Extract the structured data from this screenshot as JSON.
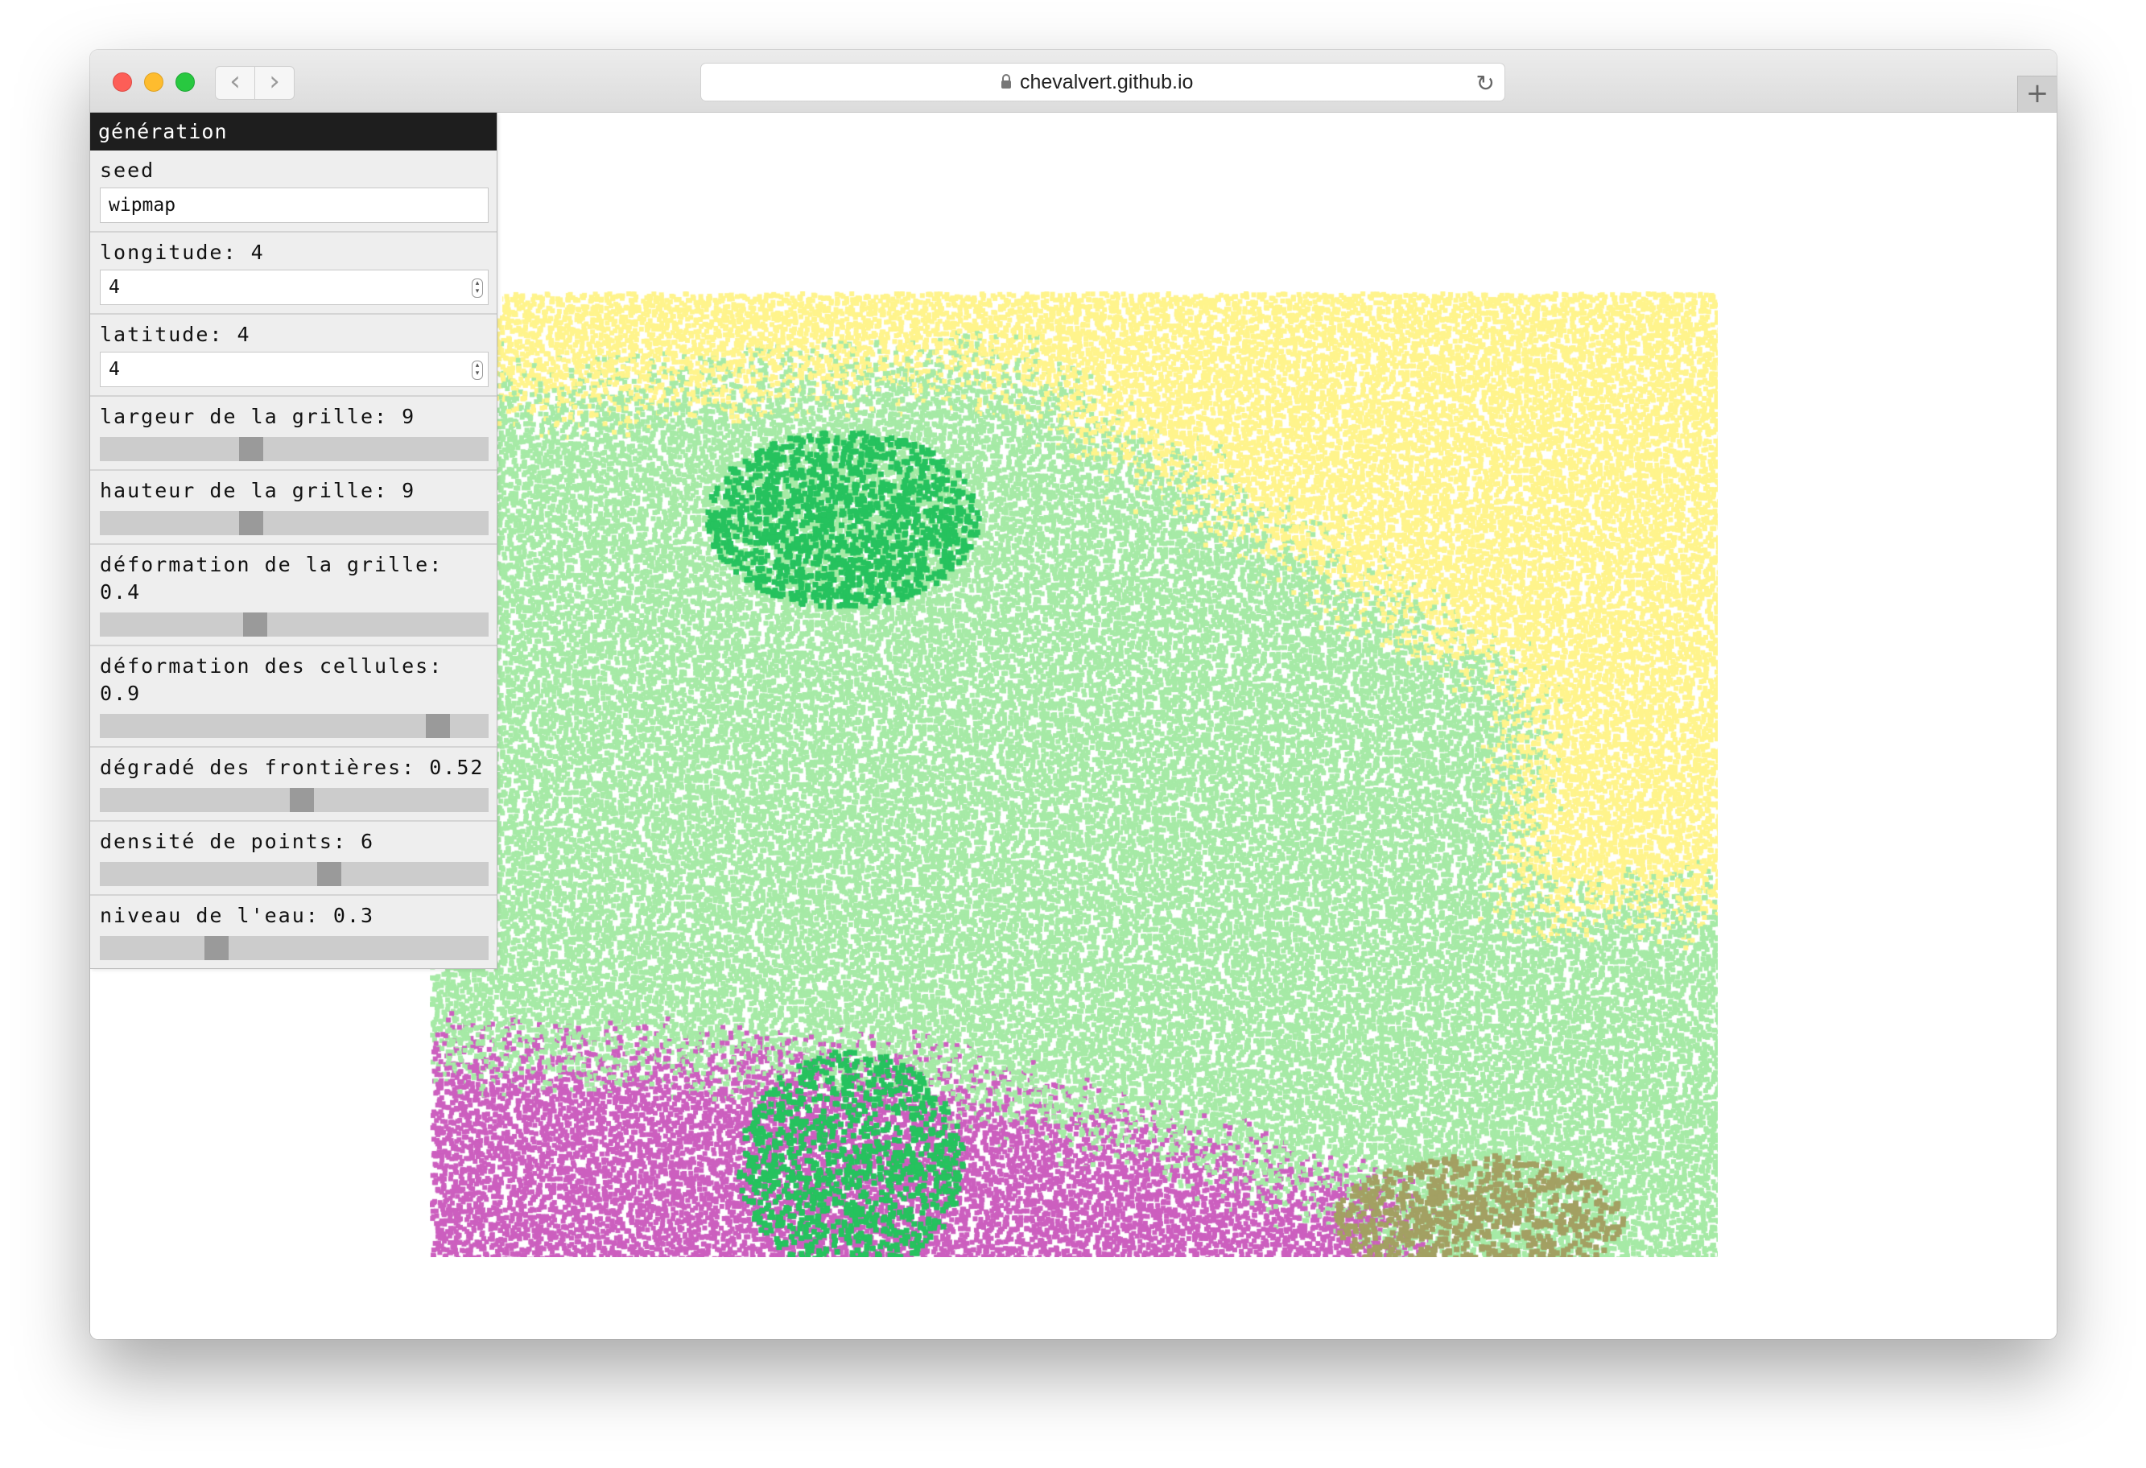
{
  "browser": {
    "url": "chevalvert.github.io",
    "back_icon": "‹",
    "forward_icon": "›",
    "reload_icon": "↻",
    "new_tab_icon": "+"
  },
  "panel": {
    "title": "génération",
    "seed": {
      "label": "seed",
      "value": "wipmap"
    },
    "longitude": {
      "label": "longitude",
      "value": "4",
      "input_value": "4"
    },
    "latitude": {
      "label": "latitude",
      "value": "4",
      "input_value": "4"
    },
    "sliders": [
      {
        "label": "largeur de la grille",
        "value": "9",
        "fraction": 0.39
      },
      {
        "label": "hauteur de la grille",
        "value": "9",
        "fraction": 0.39
      },
      {
        "label": "déformation de la grille",
        "value": "0.4",
        "fraction": 0.4
      },
      {
        "label": "déformation des cellules",
        "value": "0.9",
        "fraction": 0.87
      },
      {
        "label": "dégradé des frontières",
        "value": "0.52",
        "fraction": 0.52
      },
      {
        "label": "densité de points",
        "value": "6",
        "fraction": 0.59
      },
      {
        "label": "niveau de l'eau",
        "value": "0.3",
        "fraction": 0.3
      }
    ]
  },
  "map": {
    "colors": {
      "yellow": "#fff48c",
      "light_green": "#a6eaa6",
      "dark_green": "#26c25e",
      "magenta": "#cc5fbf",
      "olive": "#a3a063",
      "gap": "#ffffff"
    }
  }
}
